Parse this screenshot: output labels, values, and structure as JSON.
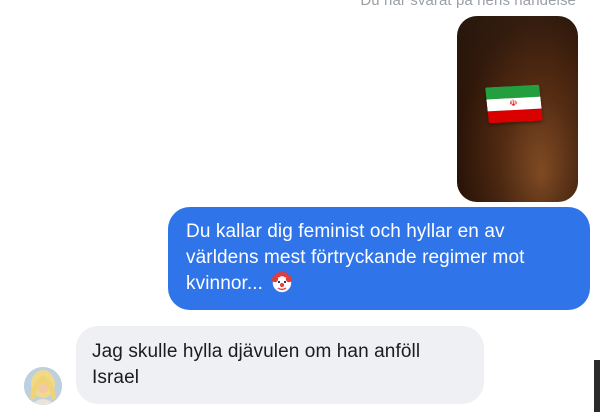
{
  "thread": {
    "reply_note": "Du har svarat på hens händelse",
    "story_icon": "iran-flag-emoji"
  },
  "messages": [
    {
      "direction": "outgoing",
      "text": "Du kallar dig feminist och hyllar en av världens mest förtryckande regimer mot kvinnor...",
      "emoji": "clown-face-emoji"
    },
    {
      "direction": "incoming",
      "text": "Jag skulle hylla djävulen om han anföll Israel"
    }
  ],
  "colors": {
    "outgoing_bubble": "#2f74e9",
    "incoming_bubble": "#eef0f3",
    "outgoing_text": "#ffffff",
    "incoming_text": "#1c1c1e",
    "note_text": "#9aa0a6"
  }
}
